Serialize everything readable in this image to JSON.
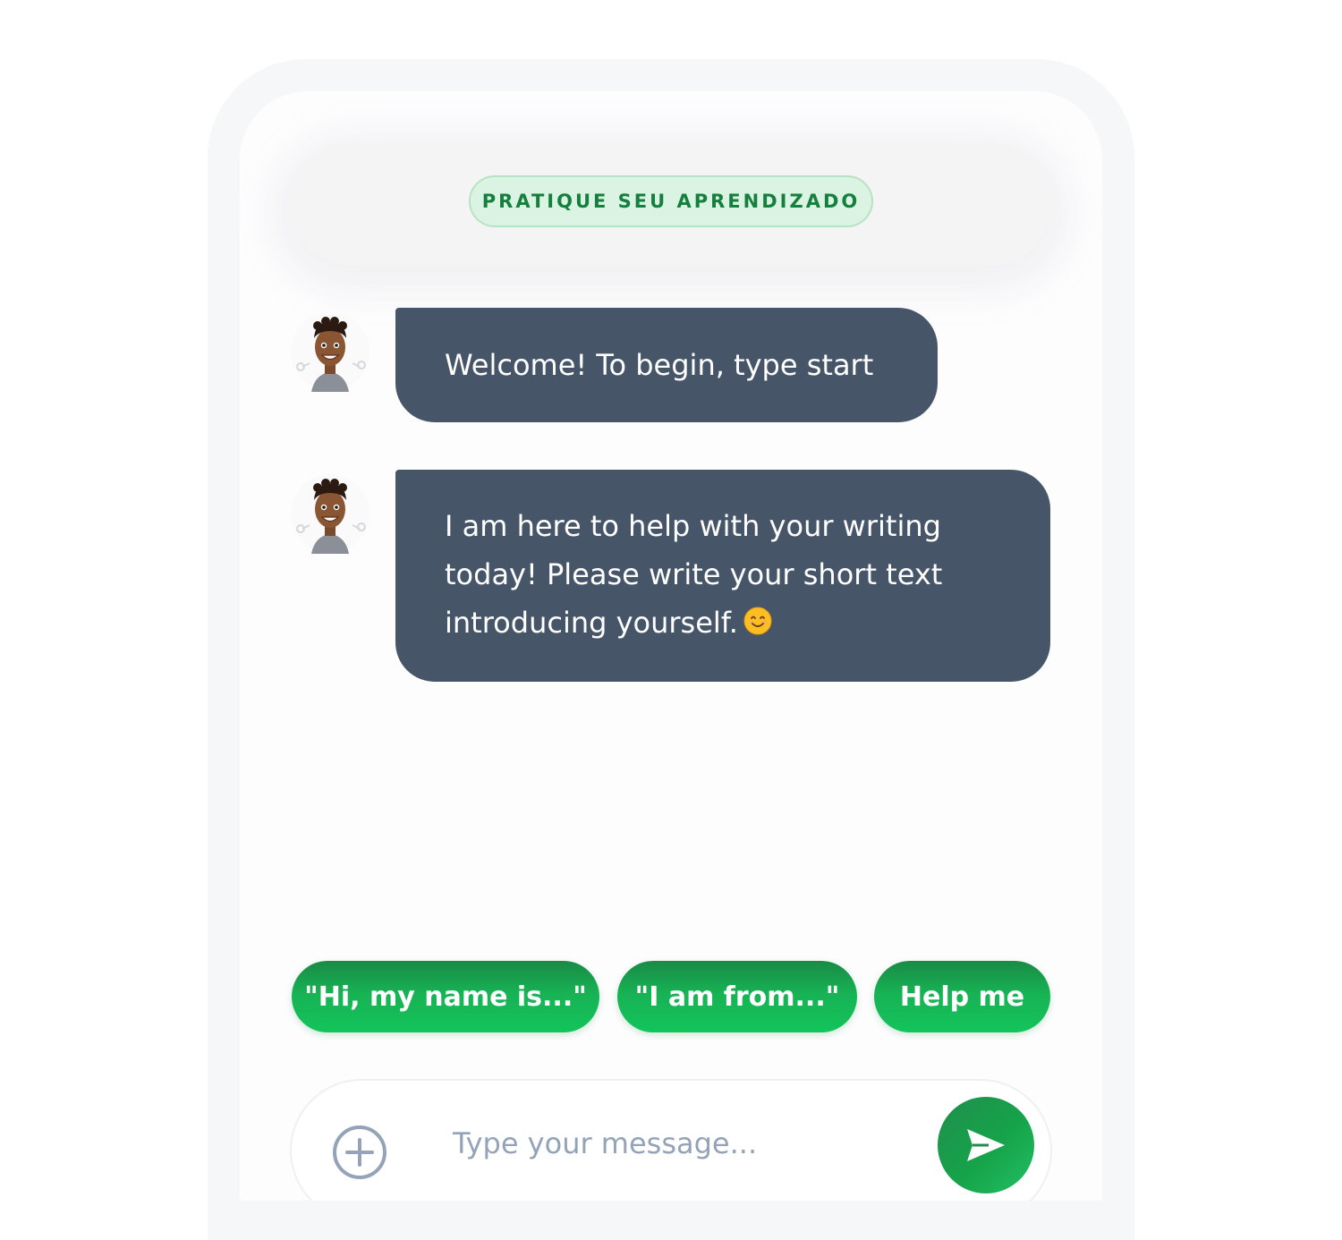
{
  "header": {
    "mode_label": "PRATIQUE SEU APRENDIZADO"
  },
  "messages": [
    {
      "sender": "assistant",
      "text": "Welcome! To begin, type start"
    },
    {
      "sender": "assistant",
      "text": "I am here to help with your writing today! Please write your short text introducing yourself.",
      "emoji": "smiling-face-emoji"
    }
  ],
  "quick_replies": [
    {
      "label": "\"Hi, my name is...\""
    },
    {
      "label": "\"I am from...\""
    },
    {
      "label": "Help me"
    }
  ],
  "composer": {
    "placeholder": "Type your message...",
    "attach_icon": "plus-circle-icon",
    "send_icon": "send-arrow-icon"
  },
  "colors": {
    "accent_green": "#16a34a",
    "bubble": "#475569",
    "badge_bg": "#daf3e2",
    "badge_text": "#15803d",
    "placeholder": "#94a3b8"
  }
}
